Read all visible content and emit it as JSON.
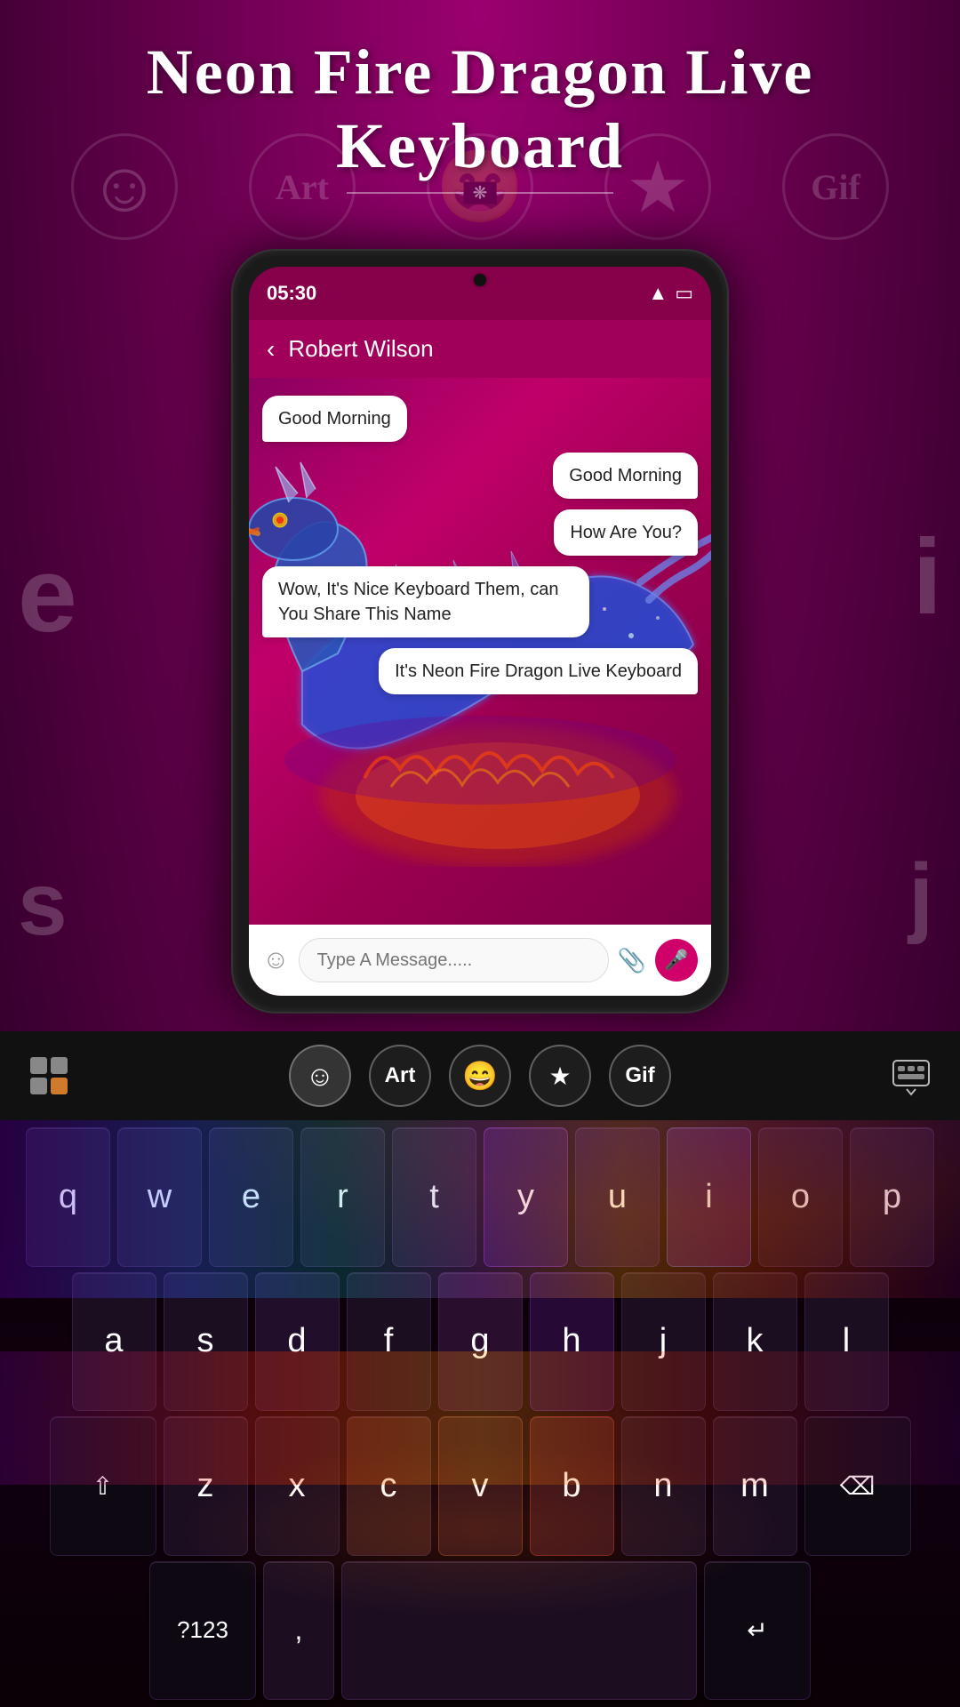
{
  "title": "Neon Fire Dragon Live Keyboard",
  "background": {
    "color": "#7b0055"
  },
  "topIcons": [
    {
      "symbol": "☺",
      "label": "emoji-icon"
    },
    {
      "text": "Art",
      "label": "art-icon"
    },
    {
      "symbol": "😄",
      "label": "laugh-icon"
    },
    {
      "symbol": "★",
      "label": "star-icon"
    },
    {
      "text": "Gif",
      "label": "gif-icon"
    }
  ],
  "phone": {
    "time": "05:30",
    "contactName": "Robert Wilson",
    "chatMessages": [
      {
        "id": 1,
        "side": "left",
        "text": "Good Morning"
      },
      {
        "id": 2,
        "side": "right",
        "text": "Good Morning"
      },
      {
        "id": 3,
        "side": "right",
        "text": "How Are You?"
      },
      {
        "id": 4,
        "side": "left",
        "text": "Wow, It's Nice Keyboard Them, can You Share This Name"
      },
      {
        "id": 5,
        "side": "right",
        "text": "It's Neon Fire Dragon Live Keyboard"
      }
    ],
    "inputPlaceholder": "Type A Message.....",
    "backButton": "‹"
  },
  "keyboard": {
    "toolbarButtons": [
      {
        "symbol": "☺",
        "label": "emoji-toolbar-btn"
      },
      {
        "text": "Art",
        "label": "art-toolbar-btn"
      },
      {
        "symbol": "😄",
        "label": "laugh-toolbar-btn"
      },
      {
        "symbol": "★",
        "label": "star-toolbar-btn"
      },
      {
        "text": "Gif",
        "label": "gif-toolbar-btn"
      }
    ],
    "rows": [
      [
        "q",
        "w",
        "e",
        "r",
        "t",
        "y",
        "u",
        "i",
        "o",
        "p"
      ],
      [
        "a",
        "s",
        "d",
        "f",
        "g",
        "h",
        "j",
        "k",
        "l"
      ],
      [
        "⇧",
        "z",
        "x",
        "c",
        "v",
        "b",
        "n",
        "m",
        "⌫"
      ],
      [
        "?123",
        ",",
        "",
        "",
        "",
        "",
        "",
        "",
        "↵"
      ]
    ]
  }
}
